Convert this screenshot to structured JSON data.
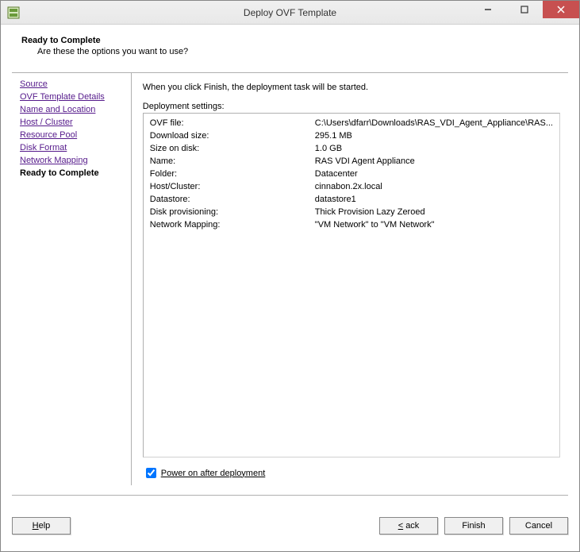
{
  "window": {
    "title": "Deploy OVF Template"
  },
  "header": {
    "title": "Ready to Complete",
    "subtitle": "Are these the options you want to use?"
  },
  "nav": {
    "items": [
      "Source",
      "OVF Template Details",
      "Name and Location",
      "Host / Cluster",
      "Resource Pool",
      "Disk Format",
      "Network Mapping"
    ],
    "current": "Ready to Complete"
  },
  "content": {
    "intro": "When you click Finish, the deployment task will be started.",
    "settings_heading": "Deployment settings:",
    "rows": [
      {
        "label": "OVF file:",
        "value": "C:\\Users\\dfarr\\Downloads\\RAS_VDI_Agent_Appliance\\RAS..."
      },
      {
        "label": "Download size:",
        "value": "295.1 MB"
      },
      {
        "label": "Size on disk:",
        "value": "1.0 GB"
      },
      {
        "label": "Name:",
        "value": "RAS VDI Agent Appliance"
      },
      {
        "label": "Folder:",
        "value": "Datacenter"
      },
      {
        "label": "Host/Cluster:",
        "value": "cinnabon.2x.local"
      },
      {
        "label": "Datastore:",
        "value": "datastore1"
      },
      {
        "label": "Disk provisioning:",
        "value": "Thick Provision Lazy Zeroed"
      },
      {
        "label": "Network Mapping:",
        "value": "\"VM Network\" to \"VM Network\""
      }
    ],
    "checkbox_label": "Power on after deployment",
    "checkbox_checked": true
  },
  "buttons": {
    "help": "Help",
    "back": "Back",
    "finish": "Finish",
    "cancel": "Cancel"
  }
}
